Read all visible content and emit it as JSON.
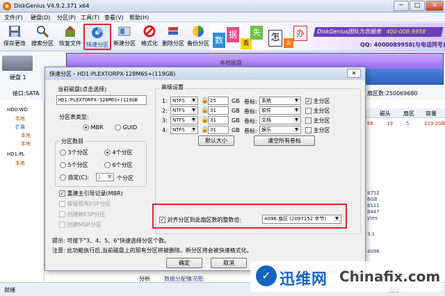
{
  "app": {
    "title": "DiskGenius V4.9.2.371 x64",
    "min": "─",
    "max": "□",
    "close": "✕"
  },
  "menu": [
    "文件(F)",
    "硬盘(D)",
    "分区(P)",
    "工具(T)",
    "查看(V)",
    "帮助(H)"
  ],
  "toolbar": [
    {
      "label": "保存更改",
      "icon": "save-icon"
    },
    {
      "label": "搜索分区",
      "icon": "search-icon"
    },
    {
      "label": "恢复文件",
      "icon": "restore-icon"
    },
    {
      "label": "快速分区",
      "icon": "quick-partition-icon"
    },
    {
      "label": "新建分区",
      "icon": "new-partition-icon"
    },
    {
      "label": "格式化",
      "icon": "format-icon"
    },
    {
      "label": "删除分区",
      "icon": "delete-icon"
    },
    {
      "label": "备份分区",
      "icon": "backup-icon"
    }
  ],
  "ad": {
    "chars": [
      "数",
      "据",
      "丢",
      "失",
      "怎",
      "么",
      "办"
    ],
    "slogan": "DiskGenius团队为您服务",
    "phone": "400-008-9958",
    "qq": "QQ: 4000089958(与电话同号)"
  },
  "diskinfo": {
    "disk_label": "硬盘 1",
    "iface": "接口:SATA",
    "sectors": "扇区数:250069680",
    "bar_text": "本地磁盘"
  },
  "tree": {
    "nodes": [
      "HD0:WD",
      "本地",
      "扩展",
      "本地",
      "本地",
      "HD1:PL",
      "本地"
    ]
  },
  "table_right": {
    "headers": [
      "磁头",
      "扇区",
      "容量"
    ],
    "row": [
      "66",
      "19",
      "5",
      "119.2GB"
    ],
    "values": [
      "8752",
      "6GB",
      "8111",
      "8447",
      "ytes",
      "3.1",
      "4096"
    ]
  },
  "bottom_tabs": [
    "分析",
    "数据分配情况图:"
  ],
  "status": {
    "left": "就绪",
    "right": "数字"
  },
  "dialog": {
    "title": "快速分区 - HD1:PLEXTORPX-128M6S+(119GB)",
    "close": "✕",
    "current_disk_label": "当前磁盘(点击选择)",
    "current_disk_value": "HD1:PLEXTORPX-128M6S+(119GB",
    "pt_type_label": "分区表类型:",
    "pt_mbr": "MBR",
    "pt_guid": "GUID",
    "count_label": "分区数目",
    "count_opts": [
      "3个分区",
      "4个分区",
      "5个分区",
      "6个分区"
    ],
    "custom_label": "自定(C):",
    "custom_value": "2",
    "custom_suffix": "个分区",
    "mbr_rebuild": "重建主引导记录(MBR)",
    "opt_keep_esp": "保留现有ESP分区",
    "opt_new_esp": "创建新ESP分区",
    "opt_msr": "创建MSR分区",
    "adv_label": "高级设置",
    "rows": [
      {
        "n": "1:",
        "fs": "NTFS",
        "size": "25",
        "unit": "GB",
        "vlabel": "卷标:",
        "vol": "系统",
        "primary": "主分区",
        "primary_checked": true
      },
      {
        "n": "2:",
        "fs": "NTFS",
        "size": "31",
        "unit": "GB",
        "vlabel": "卷标:",
        "vol": "软件",
        "primary": "主分区",
        "primary_checked": false
      },
      {
        "n": "3:",
        "fs": "NTFS",
        "size": "31",
        "unit": "GB",
        "vlabel": "卷标:",
        "vol": "文档",
        "primary": "主分区",
        "primary_checked": false
      },
      {
        "n": "4:",
        "fs": "NTFS",
        "size": "31",
        "unit": "GB",
        "vlabel": "卷标:",
        "vol": "娱乐",
        "primary": "主分区",
        "primary_checked": false
      }
    ],
    "btn_default_size": "默认大小",
    "btn_clear_labels": "清空所有卷标",
    "align_label": "对齐分区到此扇区数的整数倍:",
    "align_value": "4096 扇区 (2097152 字节)",
    "hint1": "提示: 可按下\"3、4、5、6\"快速选择分区个数。",
    "hint2": "注意: 此功能执行后,当前磁盘上的现有分区将被删除。新分区将会被快速格式化。",
    "ok": "确定",
    "cancel": "取消"
  },
  "watermark": {
    "cn": "迅维网",
    "en": "Chinafix.com"
  },
  "colors": {
    "highlight_red": "#e0242a",
    "disk_bar_purple": "#a37cf2",
    "disk_bar_blue": "#4c80d8",
    "dialog_bg": "#f0f0f0"
  }
}
